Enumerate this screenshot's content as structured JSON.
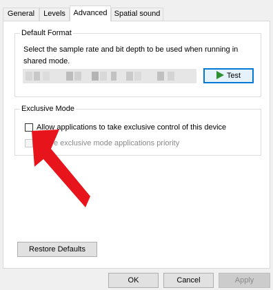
{
  "tabs": [
    {
      "label": "General"
    },
    {
      "label": "Levels"
    },
    {
      "label": "Advanced",
      "active": true
    },
    {
      "label": "Spatial sound"
    }
  ],
  "default_format": {
    "title": "Default Format",
    "description": "Select the sample rate and bit depth to be used when running in shared mode.",
    "selected_value_obscured": true,
    "test_button": "Test"
  },
  "exclusive_mode": {
    "title": "Exclusive Mode",
    "allow_exclusive": {
      "label": "Allow applications to take exclusive control of this device",
      "checked": false
    },
    "priority": {
      "label": "e exclusive mode applications priority",
      "checked": false,
      "enabled": false
    }
  },
  "restore_defaults": "Restore Defaults",
  "footer": {
    "ok": "OK",
    "cancel": "Cancel",
    "apply": "Apply"
  },
  "colors": {
    "accent": "#0078d7",
    "annotation_arrow": "#e8141c",
    "play_icon": "#2d8f2d"
  }
}
